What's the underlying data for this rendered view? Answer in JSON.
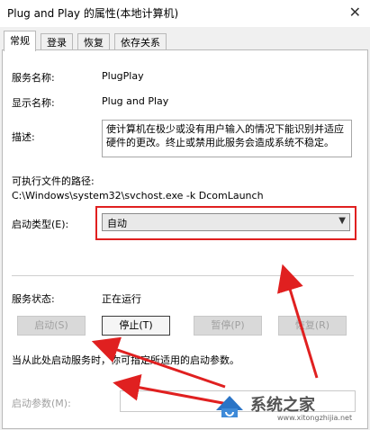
{
  "window": {
    "title": "Plug and Play 的属性(本地计算机)",
    "close": "✕"
  },
  "tabs": [
    {
      "label": "常规",
      "active": true
    },
    {
      "label": "登录",
      "active": false
    },
    {
      "label": "恢复",
      "active": false
    },
    {
      "label": "依存关系",
      "active": false
    }
  ],
  "fields": {
    "service_name_label": "服务名称:",
    "service_name": "PlugPlay",
    "display_name_label": "显示名称:",
    "display_name": "Plug and Play",
    "description_label": "描述:",
    "description": "使计算机在极少或没有用户输入的情况下能识别并适应硬件的更改。终止或禁用此服务会造成系统不稳定。",
    "exe_path_label": "可执行文件的路径:",
    "exe_path": "C:\\Windows\\system32\\svchost.exe -k DcomLaunch",
    "startup_type_label": "启动类型(E):",
    "startup_type": "自动",
    "status_label": "服务状态:",
    "status_value": "正在运行"
  },
  "buttons": {
    "start": "启动(S)",
    "stop": "停止(T)",
    "pause": "暂停(P)",
    "resume": "恢复(R)"
  },
  "hint": "当从此处启动服务时，你可指定所适用的启动参数。",
  "param_label": "启动参数(M):",
  "watermark": {
    "text": "系统之家",
    "url": "www.xitongzhijia.net"
  },
  "colors": {
    "highlight": "#e02020"
  }
}
